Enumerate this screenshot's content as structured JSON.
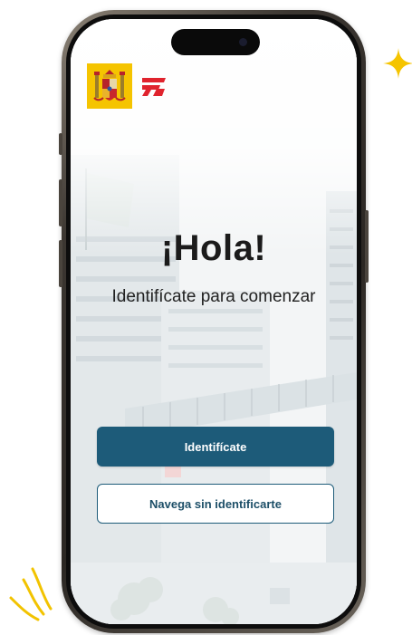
{
  "welcome": {
    "greeting": "¡Hola!",
    "subtitle": "Identifícate para comenzar"
  },
  "actions": {
    "login_label": "Identifícate",
    "browse_label": "Navega sin identificarte"
  },
  "branding": {
    "crest_icon": "spain-coat-of-arms-icon",
    "logo_icon": "agency-logo-icon"
  },
  "decorations": {
    "sparkle_icon": "sparkle-icon",
    "scribble_icon": "motion-lines-icon"
  },
  "colors": {
    "primary": "#1d5b79",
    "primary_text": "#ffffff",
    "secondary_border": "#1d5b79",
    "secondary_text": "#1d4f68",
    "crest_yellow": "#f5c400",
    "logo_red": "#e0232d",
    "sparkle_yellow": "#f5c400"
  }
}
